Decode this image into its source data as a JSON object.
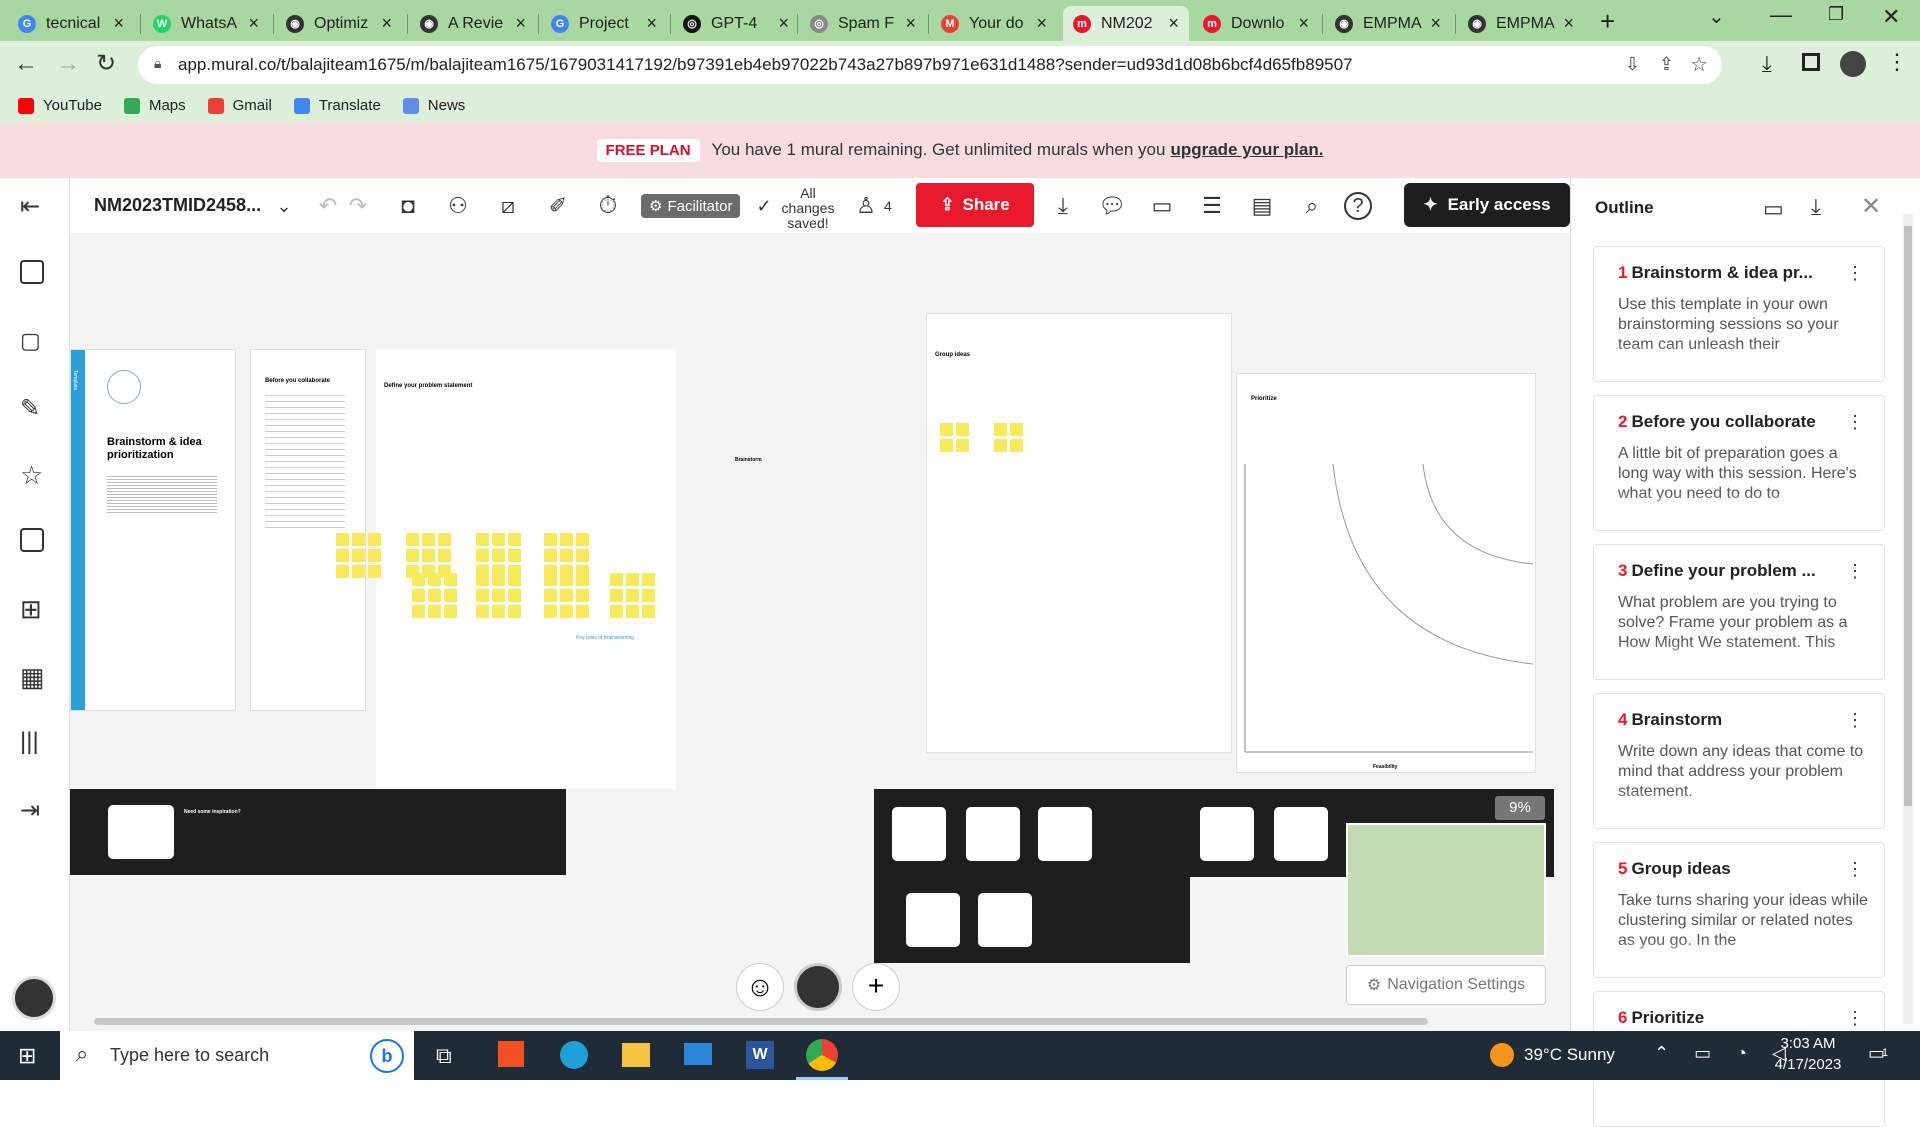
{
  "browser": {
    "tabs": [
      {
        "title": "tecnical",
        "fav": "G",
        "color": "#4285f4"
      },
      {
        "title": "WhatsA",
        "fav": "W",
        "color": "#25d366"
      },
      {
        "title": "Optimiz",
        "fav": "◉",
        "color": "#333333"
      },
      {
        "title": "A Revie",
        "fav": "◉",
        "color": "#333333"
      },
      {
        "title": "Project",
        "fav": "G",
        "color": "#4285f4"
      },
      {
        "title": "GPT-4",
        "fav": "◎",
        "color": "#111111"
      },
      {
        "title": "Spam F",
        "fav": "◎",
        "color": "#888888"
      },
      {
        "title": "Your do",
        "fav": "M",
        "color": "#ea4335"
      },
      {
        "title": "NM202",
        "fav": "m",
        "color": "#e8192c"
      },
      {
        "title": "Downlo",
        "fav": "m",
        "color": "#e8192c"
      },
      {
        "title": "EMPMA",
        "fav": "◉",
        "color": "#333333"
      },
      {
        "title": "EMPMA",
        "fav": "◉",
        "color": "#333333"
      }
    ],
    "url": "app.mural.co/t/balajiteam1675/m/balajiteam1675/1679031417192/b97391eb4eb97022b743a27b897b971e631d1488?sender=ud93d1d08b6bcf4d65fb89507",
    "bookmarks": [
      "YouTube",
      "Maps",
      "Gmail",
      "Translate",
      "News"
    ]
  },
  "banner": {
    "plan": "FREE PLAN",
    "text": "You have 1 mural remaining. Get unlimited murals when you",
    "link": "upgrade your plan."
  },
  "toolbar": {
    "mural_name": "NM2023TMID2458...",
    "facilitator": "Facilitator",
    "saved": "All changes saved!",
    "participants": "4",
    "share": "Share",
    "early_access": "Early access"
  },
  "canvas": {
    "template_title": "Brainstorm & idea prioritization",
    "template_tag": "Template",
    "before_title": "Before you collaborate",
    "define_title": "Define your problem statement",
    "brainstorm_title": "Brainstorm",
    "group_title": "Group ideas",
    "prioritize_title": "Prioritize",
    "feasibility": "Feasibility",
    "key_rules": "Key rules of brainstorming",
    "need_inspiration": "Need some inspiration?",
    "zoom": "9%",
    "nav_settings": "Navigation Settings"
  },
  "outline": {
    "title": "Outline",
    "items": [
      {
        "num": "1",
        "title": "Brainstorm  & idea pr...",
        "desc": "Use this template in your own brainstorming sessions so your team can unleash their"
      },
      {
        "num": "2",
        "title": "Before you collaborate",
        "desc": "A little bit of preparation goes a long way with this session. Here's what you need to do to"
      },
      {
        "num": "3",
        "title": "Define your problem ...",
        "desc": "What problem are you trying to solve? Frame your problem as a How Might We statement. This"
      },
      {
        "num": "4",
        "title": "Brainstorm",
        "desc": "Write down any ideas that come to mind that address your problem statement."
      },
      {
        "num": "5",
        "title": "Group ideas",
        "desc": "Take turns sharing your ideas while clustering similar or related notes as you go. In the"
      },
      {
        "num": "6",
        "title": "Prioritize",
        "desc": ""
      }
    ]
  },
  "taskbar": {
    "search_placeholder": "Type here to search",
    "weather": "39°C  Sunny",
    "time": "3:03 AM",
    "date": "4/17/2023",
    "notifications": "1"
  }
}
